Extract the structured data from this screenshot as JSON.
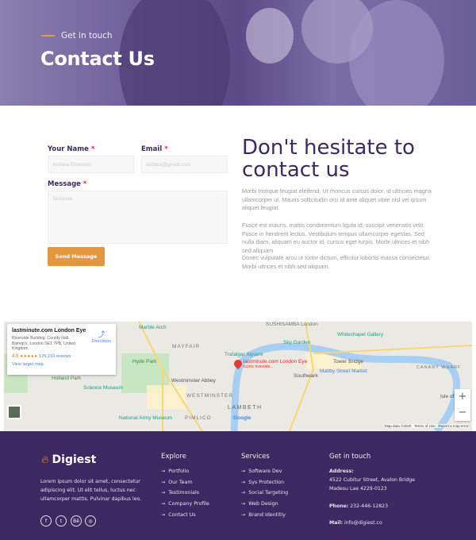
{
  "hero": {
    "eyebrow": "Get in touch",
    "title": "Contact Us"
  },
  "form": {
    "name_label": "Your Name",
    "email_label": "Email",
    "message_label": "Message",
    "required_mark": "*",
    "name_placeholder": "Andara Emerson",
    "email_placeholder": "andara@gmail.com",
    "message_placeholder": "Textarea",
    "submit_label": "Send Message"
  },
  "intro": {
    "heading": "Don't hesitate to contact us",
    "paragraphs": [
      "Morbi tristique feugiat eleifend. Ut rhoncus cursus dolor, id ultricies magna ullamcorper ut. Mauris sollicitudin orci id ante aliquet vitae nisl vel ipsum aliquet feugiat.",
      "Fusce est mauris, mattis condimentum ligula id, suscipit venenatis velit. Fusce in hendrerit lectus. Vestibulum tempus ullamcorper egestas. Sed nulla diam, aliquam eu auctor id, cursus eget turpis. Morbi ultrices et nibh sed aliquam",
      "Donec vulputate arcu ut tortor dictum, efficitur lobortis massa consectetur. Morbi ultrices et nibh sed aliquam."
    ]
  },
  "map": {
    "card": {
      "name": "lastminute.com London Eye",
      "address": "Riverside Building, County Hall, Bishop's, London SE1 7PB, United Kingdom",
      "rating": "4.5",
      "stars": "★★★★★",
      "reviews": "125,210 reviews",
      "directions": "Directions",
      "larger_map": "View larger map"
    },
    "labels": {
      "marble_arch": "Marble Arch",
      "mayfair": "MAYFAIR",
      "hyde_park": "Hyde Park",
      "holland_park": "Holland Park",
      "science_museum": "Science Museum",
      "trafalgar": "Trafalgar Square",
      "westminster_abbey": "Westminster Abbey",
      "westminster": "WESTMINSTER",
      "lambeth": "LAMBETH",
      "pimlico": "PIMLICO",
      "army_museum": "National Army Museum",
      "pin_title": "lastminute.com London Eye",
      "pin_sub": "Iconic riverside...",
      "sushisamba": "SUSHISAMBA London",
      "sky_garden": "Sky Garden",
      "whitechapel": "Whitechapel Gallery",
      "tower_bridge": "Tower Bridge",
      "maltby": "Maltby Street Market",
      "southwark": "Southwark",
      "canary": "CANARY WHARF",
      "isle": "Isle of",
      "google": "Google"
    },
    "footer": {
      "data": "Map data ©2020",
      "terms": "Terms of Use",
      "report": "Report a map error"
    },
    "zoom_in": "+",
    "zoom_out": "−"
  },
  "footer": {
    "brand": "Digiest",
    "about": "Lorem ipsum dolor sit amet, consectetur adipiscing elit. Ut elit tellus, luctus nec ullamcorper mattis. Pulvinar dapibus leo.",
    "social": [
      "f",
      "t",
      "Bē",
      "◎"
    ],
    "explore": {
      "title": "Explore",
      "links": [
        "Portfolio",
        "Our Team",
        "Testimonials",
        "Company Profile",
        "Contact Us"
      ]
    },
    "services": {
      "title": "Services",
      "links": [
        "Software Dev",
        "Sys Protection",
        "Social Targeting",
        "Web Design",
        "Brand Identitiy"
      ]
    },
    "contact": {
      "title": "Get in touch",
      "address_label": "Address:",
      "address_line1": "4522 Cubitur Street, Avalon Bridge",
      "address_line2": "Madesu Lae 4229-0123",
      "phone_label": "Phone:",
      "phone": "232-446-12823",
      "mail_label": "Mail:",
      "mail": "info@digiest.co"
    },
    "arrow": "→"
  },
  "colors": {
    "brand": "#3d2861",
    "accent": "#e3983f",
    "heading": "#3c2a5e"
  }
}
